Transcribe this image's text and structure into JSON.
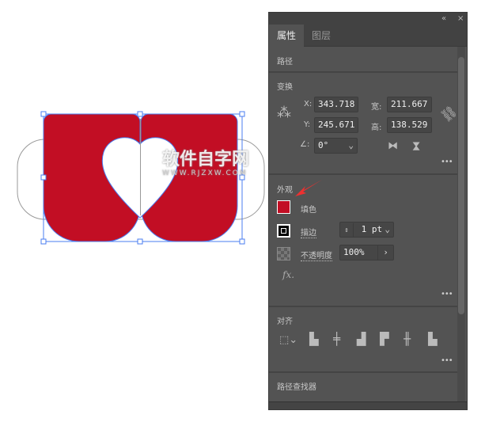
{
  "panel": {
    "collapse_icon": "«",
    "close_icon": "×",
    "tabs": [
      {
        "label": "属性"
      },
      {
        "label": "图层"
      }
    ],
    "object_type": "路径",
    "transform": {
      "title": "变换",
      "x_label": "X:",
      "x": "343.718",
      "y_label": "Y:",
      "y": "245.671",
      "w_label": "宽:",
      "w": "211.667",
      "h_label": "高:",
      "h": "138.529",
      "angle_label": "∠:",
      "angle": "0°"
    },
    "appearance": {
      "title": "外观",
      "fill_label": "填色",
      "fill_color": "#c20e24",
      "stroke_label": "描边",
      "stroke_weight": "1 pt",
      "opacity_label": "不透明度",
      "opacity": "100%",
      "fx": "fx."
    },
    "align": {
      "title": "对齐"
    },
    "pathfinder": {
      "title": "路径查找器"
    },
    "more": "•••"
  },
  "canvas": {
    "fill_color": "#c20e24",
    "selection_color": "#4a7cf0",
    "watermark_main": "软件自字网",
    "watermark_url": "WWW.RJZXW.COM"
  }
}
